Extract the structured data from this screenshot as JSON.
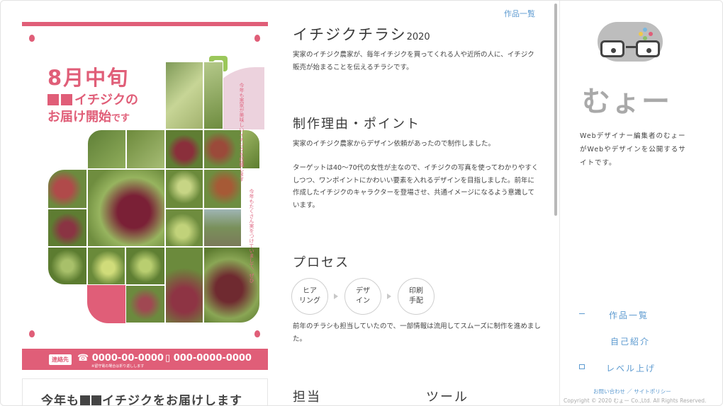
{
  "header": {
    "works_link": "作品一覧"
  },
  "flyer": {
    "headline": "8月中旬",
    "sub1_text": "イチジクの",
    "sub2_text": "お届け開始",
    "sub2_suffix": "です",
    "vertical_text_1": "今年も実家が美味しいイチジクを収穫します",
    "vertical_text_2": "今年もたくさん実をつけていまして、ぜひ",
    "contact_badge": "連絡先",
    "phone1": "0000-00-0000",
    "phone1_note": "※留守電の場合は折り返しします",
    "phone2": "000-0000-0000",
    "second_flyer_title_pre": "今年も",
    "second_flyer_title_post": "イチジクをお届けします",
    "accent_color": "#e05e78"
  },
  "article": {
    "title": "イチジクチラシ",
    "title_year": "2020",
    "intro": "実家のイチジク農家が、毎年イチジクを買ってくれる人や近所の人に、イチジク販売が始まることを伝えるチラシです。",
    "reason_heading": "制作理由・ポイント",
    "reason_p1": "実家のイチジク農家からデザイン依頼があったので制作しました。",
    "reason_p2": "ターゲットは40〜70代の女性が主なので、イチジクの写真を使ってわかりやすくしつつ、ワンポイントにかわいい要素を入れるデザインを目指しました。前年に作成したイチジクのキャラクターを登場させ、共通イメージになるよう意識しています。",
    "process_heading": "プロセス",
    "steps": [
      {
        "line1": "ヒア",
        "line2": "リング"
      },
      {
        "line1": "デザ",
        "line2": "イン"
      },
      {
        "line1": "印刷",
        "line2": "手配"
      }
    ],
    "process_note": "前年のチラシも担当していたので、一部情報は流用してスムーズに制作を進めました。",
    "role_heading": "担当",
    "tools_heading": "ツール"
  },
  "sidebar": {
    "brand": "むょー",
    "description": "Webデザイナー編集者のむょーがWebやデザインを公開するサイトです。",
    "nav": [
      "作品一覧",
      "自己紹介",
      "レベル上げ"
    ],
    "footer_links": "お問い合わせ ／ サイトポリシー",
    "copyright": "Copyright © 2020 むょー Co.,Ltd. All Rights Reserved.",
    "link_color": "#5c9ad0"
  }
}
